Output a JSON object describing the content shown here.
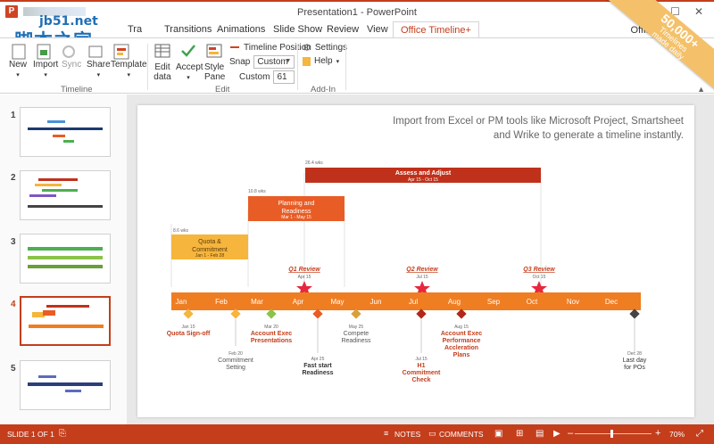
{
  "window": {
    "title": "Presentation1 - PowerPoint",
    "user": "Office",
    "watermark_url": "jb51.net",
    "watermark_text": "脚本之家",
    "controls": [
      "?",
      "–",
      "☐",
      "✕"
    ]
  },
  "tabs": [
    "Tra",
    "Transitions",
    "Animations",
    "Slide Show",
    "Review",
    "View",
    "Office Timeline+"
  ],
  "active_tab": "Office Timeline+",
  "promo": {
    "count": "50,000+",
    "line1": "Timelines",
    "line2": "made daily"
  },
  "ribbon": {
    "timeline_group": {
      "label": "Timeline",
      "buttons": [
        "New",
        "Import",
        "Sync",
        "Share",
        "Template"
      ]
    },
    "edit_group": {
      "label": "Edit",
      "edit_data_line1": "Edit",
      "edit_data_line2": "data",
      "accept": "Accept",
      "style_pane_line1": "Style",
      "style_pane_line2": "Pane",
      "timeline_position": "Timeline Position",
      "snap_label": "Snap",
      "snap_value": "Custom",
      "custom_label": "Custom",
      "custom_value": "61"
    },
    "addin_group": {
      "label": "Add-In",
      "settings": "Settings",
      "help": "Help"
    }
  },
  "slides": {
    "numbers": [
      "1",
      "2",
      "3",
      "4",
      "5"
    ],
    "selected": "4"
  },
  "slide": {
    "caption_line1": "Import from Excel or PM tools like Microsoft Project, Smartsheet",
    "caption_line2": "and Wrike to generate a timeline instantly.",
    "months": [
      "Jan",
      "Feb",
      "Mar",
      "Apr",
      "May",
      "Jun",
      "Jul",
      "Aug",
      "Sep",
      "Oct",
      "Nov",
      "Dec"
    ],
    "tasks": [
      {
        "name_line1": "Quota &",
        "name_line2": "Commitment",
        "dates": "Jan 1 - Feb 28",
        "duration": "8.6 wks",
        "color": "#f6b53d"
      },
      {
        "name_line1": "Planning and",
        "name_line2": "Readiness",
        "dates": "Mar 1 - May 15",
        "duration": "10.8 wks",
        "color": "#e85d25"
      },
      {
        "name_line1": "Assess and Adjust",
        "name_line2": "",
        "dates": "Apr 15 - Oct 15",
        "duration": "26.4 wks",
        "color": "#c0311b"
      }
    ],
    "reviews": [
      {
        "label": "Q1 Review",
        "date": "Apr 15"
      },
      {
        "label": "Q2 Review",
        "date": "Jul 15"
      },
      {
        "label": "Q3 Review",
        "date": "Oct 15"
      }
    ],
    "milestones_above": [
      {
        "date": "Jan 15",
        "label_line1": "Quota Sign-off",
        "label_line2": "",
        "label_line3": "",
        "color": "#f6b53d",
        "text_color": "#c43e1c"
      },
      {
        "date": "Mar 20",
        "label_line1": "Account Exec",
        "label_line2": "Presentations",
        "label_line3": "",
        "color": "#8bc34a",
        "text_color": "#c43e1c"
      },
      {
        "date": "May 25",
        "label_line1": "Compete",
        "label_line2": "Readiness",
        "label_line3": "",
        "color": "#d9a03a",
        "text_color": "#555555"
      },
      {
        "date": "Aug 15",
        "label_line1": "Account Exec",
        "label_line2": "Performance",
        "label_line3": "Accleration",
        "label_line4": "Plans",
        "color": "#b0281a",
        "text_color": "#c43e1c"
      }
    ],
    "milestones_below": [
      {
        "date": "Feb 20",
        "label_line1": "Commitment",
        "label_line2": "Setting",
        "label_line3": "",
        "color": "#f6b53d",
        "text_color": "#555555"
      },
      {
        "date": "Apr 25",
        "label_line1": "Fast start",
        "label_line2": "Readiness",
        "label_line3": "",
        "color": "#e85d25",
        "text_color": "#333333"
      },
      {
        "date": "Jul 15",
        "label_line1": "H1",
        "label_line2": "Commitment",
        "label_line3": "Check",
        "color": "#b0281a",
        "text_color": "#c43e1c"
      },
      {
        "date": "Dec 28",
        "label_line1": "Last day",
        "label_line2": "for POs",
        "label_line3": "",
        "color": "#444444",
        "text_color": "#333333"
      }
    ]
  },
  "status": {
    "slide_info": "SLIDE 1 OF 1",
    "notes": "NOTES",
    "comments": "COMMENTS",
    "zoom_minus": "–",
    "zoom_plus": "+",
    "zoom": "70%"
  },
  "colors": {
    "accent": "#c43e1c",
    "timeline_bar": "#ef7d22",
    "review_star": "#e8273d"
  }
}
